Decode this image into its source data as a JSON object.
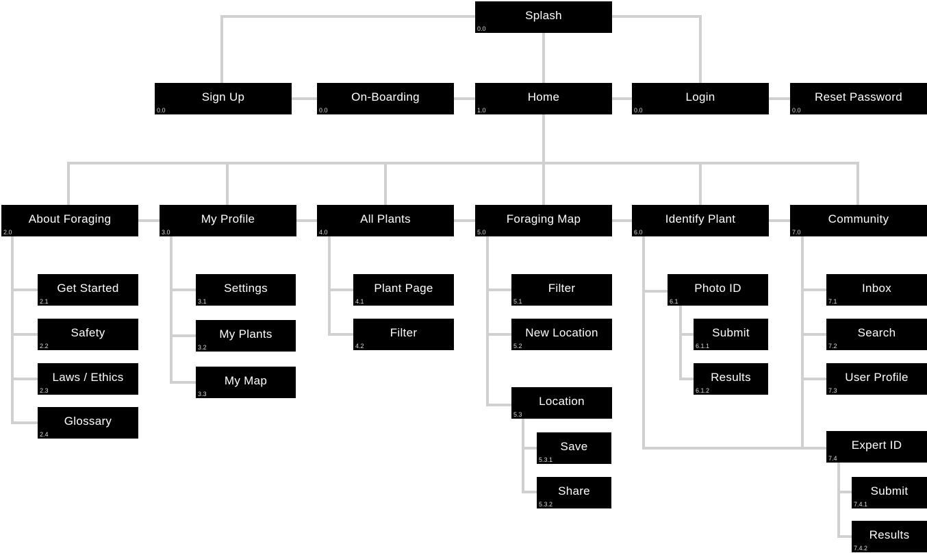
{
  "colors": {
    "node_fill": "#000000",
    "node_text": "#ffffff",
    "connector": "#d0d0d0"
  },
  "nodes": [
    {
      "id": "splash",
      "label": "Splash",
      "num": "0.0"
    },
    {
      "id": "sign-up",
      "label": "Sign Up",
      "num": "0.0"
    },
    {
      "id": "on-boarding",
      "label": "On-Boarding",
      "num": "0.0"
    },
    {
      "id": "home",
      "label": "Home",
      "num": "1.0"
    },
    {
      "id": "login",
      "label": "Login",
      "num": "0.0"
    },
    {
      "id": "reset-password",
      "label": "Reset Password",
      "num": "0.0"
    },
    {
      "id": "about-foraging",
      "label": "About Foraging",
      "num": "2.0"
    },
    {
      "id": "get-started",
      "label": "Get Started",
      "num": "2.1"
    },
    {
      "id": "safety",
      "label": "Safety",
      "num": "2.2"
    },
    {
      "id": "laws-ethics",
      "label": "Laws / Ethics",
      "num": "2.3"
    },
    {
      "id": "glossary",
      "label": "Glossary",
      "num": "2.4"
    },
    {
      "id": "my-profile",
      "label": "My Profile",
      "num": "3.0"
    },
    {
      "id": "settings",
      "label": "Settings",
      "num": "3.1"
    },
    {
      "id": "my-plants",
      "label": "My Plants",
      "num": "3.2"
    },
    {
      "id": "my-map",
      "label": "My Map",
      "num": "3.3"
    },
    {
      "id": "all-plants",
      "label": "All Plants",
      "num": "4.0"
    },
    {
      "id": "plant-page",
      "label": "Plant Page",
      "num": "4.1"
    },
    {
      "id": "plants-filter",
      "label": "Filter",
      "num": "4.2"
    },
    {
      "id": "foraging-map",
      "label": "Foraging Map",
      "num": "5.0"
    },
    {
      "id": "map-filter",
      "label": "Filter",
      "num": "5.1"
    },
    {
      "id": "new-location",
      "label": "New Location",
      "num": "5.2"
    },
    {
      "id": "location",
      "label": "Location",
      "num": "5.3"
    },
    {
      "id": "save",
      "label": "Save",
      "num": "5.3.1"
    },
    {
      "id": "share",
      "label": "Share",
      "num": "5.3.2"
    },
    {
      "id": "identify-plant",
      "label": "Identify Plant",
      "num": "6.0"
    },
    {
      "id": "photo-id",
      "label": "Photo ID",
      "num": "6.1"
    },
    {
      "id": "photo-submit",
      "label": "Submit",
      "num": "6.1.1"
    },
    {
      "id": "photo-results",
      "label": "Results",
      "num": "6.1.2"
    },
    {
      "id": "community",
      "label": "Community",
      "num": "7.0"
    },
    {
      "id": "inbox",
      "label": "Inbox",
      "num": "7.1"
    },
    {
      "id": "search",
      "label": "Search",
      "num": "7.2"
    },
    {
      "id": "user-profile",
      "label": "User Profile",
      "num": "7.3"
    },
    {
      "id": "expert-id",
      "label": "Expert ID",
      "num": "7.4"
    },
    {
      "id": "expert-submit",
      "label": "Submit",
      "num": "7.4.1"
    },
    {
      "id": "expert-results",
      "label": "Results",
      "num": "7.4.2"
    }
  ]
}
